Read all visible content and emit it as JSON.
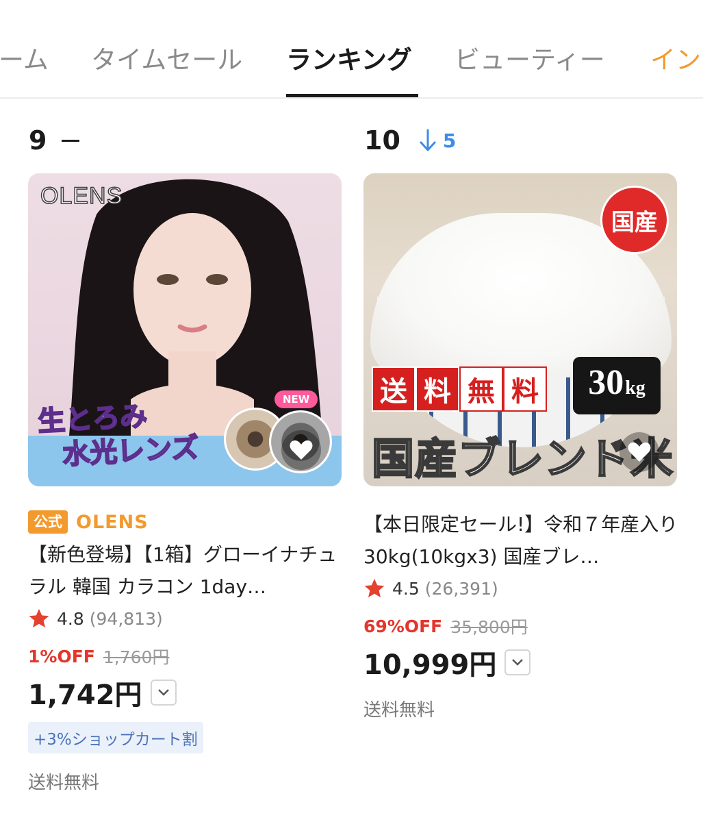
{
  "tabs": [
    {
      "label": "ーム",
      "state": "normal"
    },
    {
      "label": "タイムセール",
      "state": "normal"
    },
    {
      "label": "ランキング",
      "state": "active"
    },
    {
      "label": "ビューティー",
      "state": "normal"
    },
    {
      "label": "イン",
      "state": "accent"
    }
  ],
  "products": [
    {
      "rank": "9",
      "rank_change": "",
      "rank_trend": "same",
      "image": {
        "brand_logo": "OLENS",
        "badge_new": "NEW",
        "catch_line1": "生とろみ",
        "catch_line2": "水光レンズ"
      },
      "official_badge": "公式",
      "shop": "OLENS",
      "title": "【新色登場】【1箱】グローイナチュラル 韓国 カラコン 1day…",
      "rating": "4.8",
      "review_count": "(94,813)",
      "discount": "1%OFF",
      "original_price": "1,760円",
      "price": "1,742円",
      "coupon": "+3%ショップカート割",
      "shipping": "送料無料"
    },
    {
      "rank": "10",
      "rank_change": "5",
      "rank_trend": "down",
      "image": {
        "badge": "国産",
        "free_shipping_chars": [
          "送",
          "料",
          "無",
          "料"
        ],
        "weight_num": "30",
        "weight_unit": "kg",
        "blend_text": "国産ブレンド米"
      },
      "title": "【本日限定セール!】令和７年産入り 30kg(10kgx3) 国産ブレ…",
      "rating": "4.5",
      "review_count": "(26,391)",
      "discount": "69%OFF",
      "original_price": "35,800円",
      "price": "10,999円",
      "shipping": "送料無料"
    }
  ],
  "colors": {
    "accent_orange": "#f39a2e",
    "discount_red": "#e4362c",
    "rank_down_blue": "#3b8de6",
    "star_red": "#e5412f"
  },
  "icons": {
    "favorite": "heart-icon",
    "rating": "star-icon",
    "rank_down": "arrow-down-icon",
    "rank_same": "dash-icon",
    "price_dropdown": "chevron-down-icon"
  }
}
